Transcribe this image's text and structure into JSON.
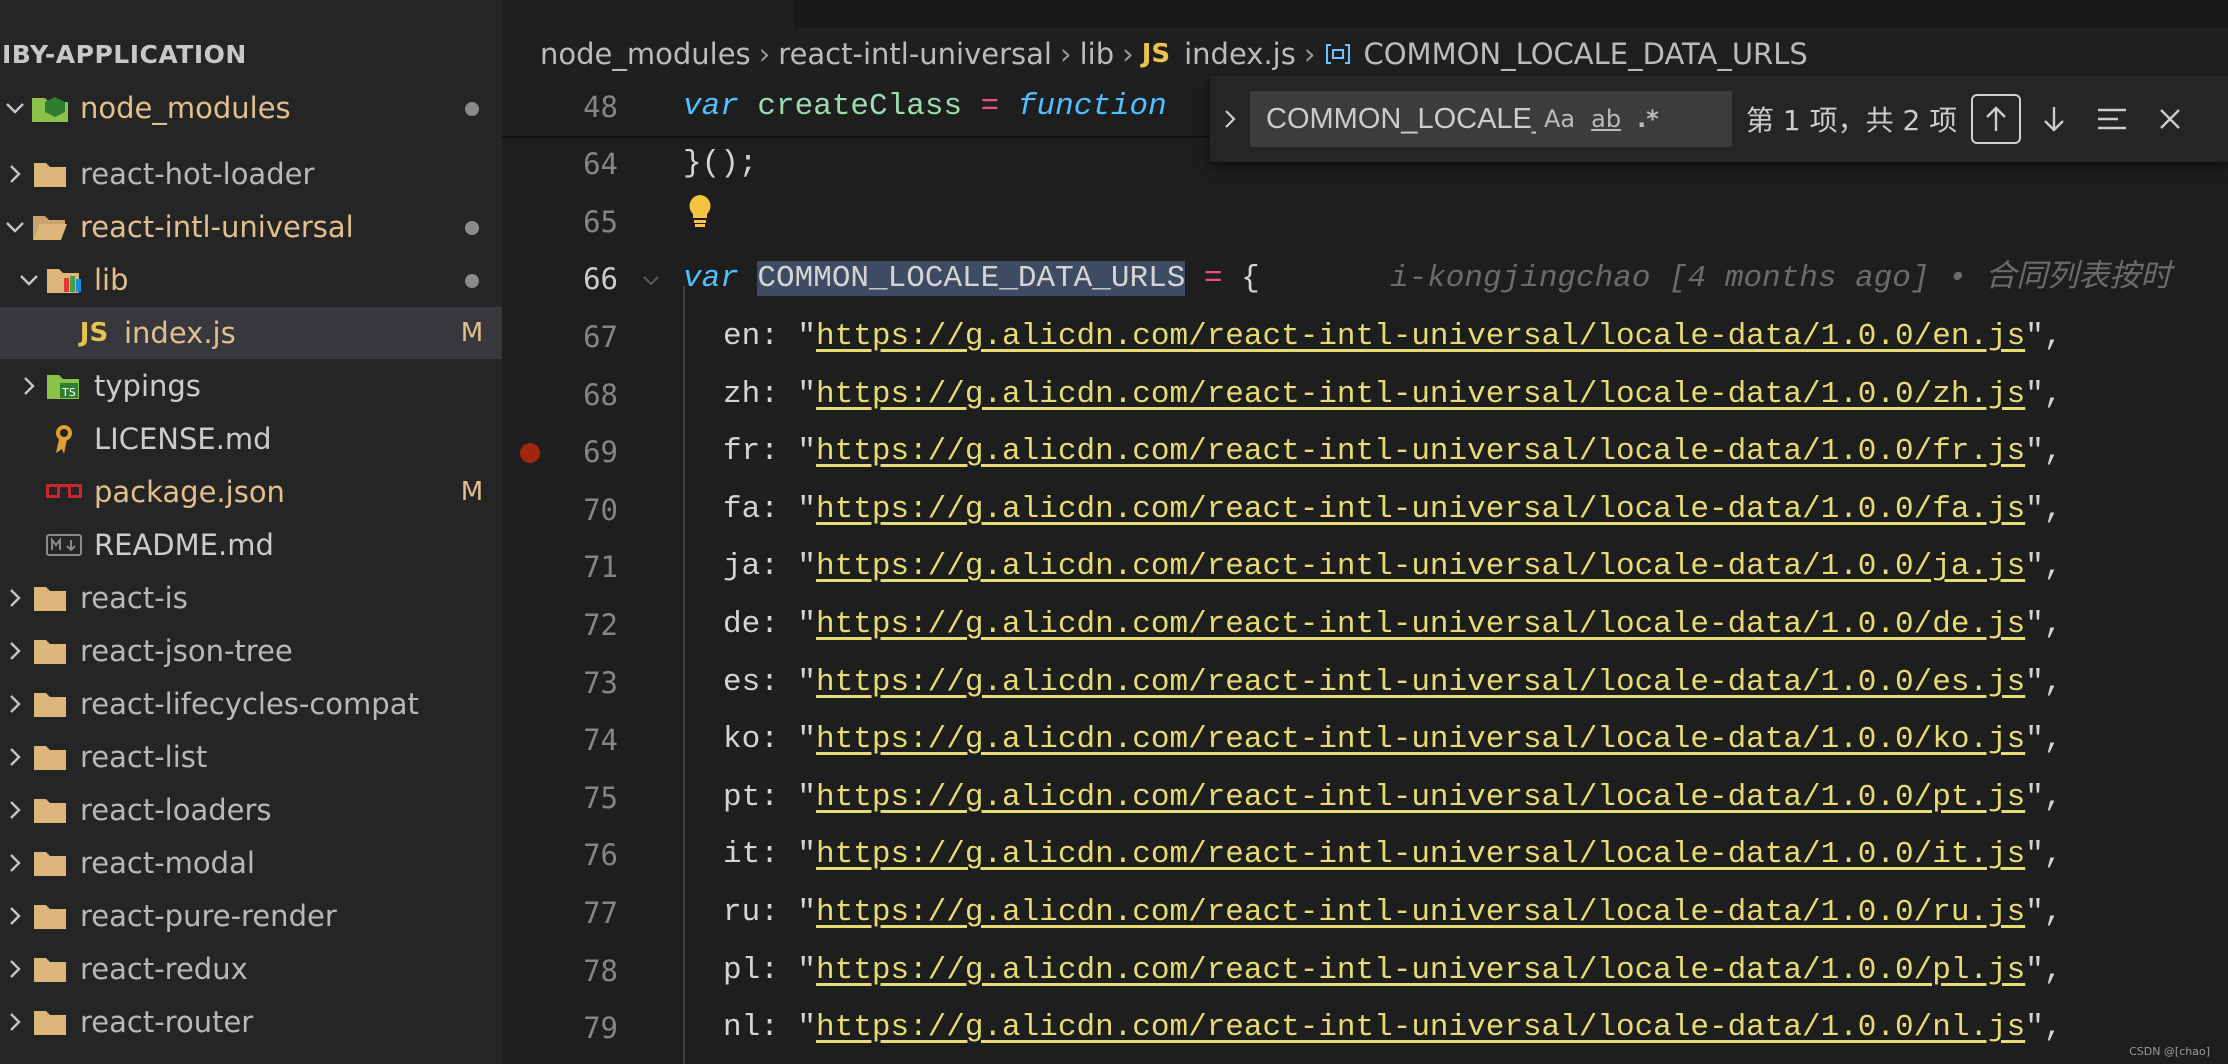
{
  "explorer": {
    "header": "IBY-APPLICATION",
    "items": [
      {
        "label": "node_modules",
        "badge": "dot",
        "kind": "folder-green",
        "chevron": "down"
      },
      {
        "label": "react-hot-loader",
        "badge": "",
        "kind": "folder",
        "chevron": "right"
      },
      {
        "label": "react-intl-universal",
        "badge": "dot",
        "kind": "folder-open",
        "chevron": "down",
        "modified": true
      },
      {
        "label": "lib",
        "badge": "dot",
        "kind": "folder-lib",
        "chevron": "down",
        "modified": true
      },
      {
        "label": "index.js",
        "badge": "M",
        "kind": "js",
        "chevron": "",
        "modified": true,
        "active": true
      },
      {
        "label": "typings",
        "badge": "",
        "kind": "folder-ts",
        "chevron": "right"
      },
      {
        "label": "LICENSE.md",
        "badge": "",
        "kind": "license",
        "chevron": ""
      },
      {
        "label": "package.json",
        "badge": "M",
        "kind": "npm",
        "chevron": "",
        "modified": true
      },
      {
        "label": "README.md",
        "badge": "",
        "kind": "markdown",
        "chevron": ""
      },
      {
        "label": "react-is",
        "badge": "",
        "kind": "folder",
        "chevron": "right"
      },
      {
        "label": "react-json-tree",
        "badge": "",
        "kind": "folder",
        "chevron": "right"
      },
      {
        "label": "react-lifecycles-compat",
        "badge": "",
        "kind": "folder",
        "chevron": "right"
      },
      {
        "label": "react-list",
        "badge": "",
        "kind": "folder",
        "chevron": "right"
      },
      {
        "label": "react-loaders",
        "badge": "",
        "kind": "folder",
        "chevron": "right"
      },
      {
        "label": "react-modal",
        "badge": "",
        "kind": "folder",
        "chevron": "right"
      },
      {
        "label": "react-pure-render",
        "badge": "",
        "kind": "folder",
        "chevron": "right"
      },
      {
        "label": "react-redux",
        "badge": "",
        "kind": "folder",
        "chevron": "right"
      },
      {
        "label": "react-router",
        "badge": "",
        "kind": "folder",
        "chevron": "right"
      }
    ]
  },
  "breadcrumb": {
    "items": [
      "node_modules",
      "react-intl-universal",
      "lib",
      "index.js",
      "COMMON_LOCALE_DATA_URLS"
    ],
    "js_badge": "JS"
  },
  "find": {
    "query": "COMMON_LOCALE_DATA_URLS",
    "match_case": "Aa",
    "whole_word": "ab",
    "regex": ".*",
    "count": "第 1 项，共 2 项"
  },
  "editor": {
    "line48": {
      "num": "48",
      "kw": "var",
      "name": "createClass",
      "op": "=",
      "fn": "function"
    },
    "line64": {
      "num": "64",
      "text": "}();"
    },
    "line65": {
      "num": "65"
    },
    "line66": {
      "num": "66",
      "kw": "var",
      "name": "COMMON_LOCALE_DATA_URLS",
      "op": "=",
      "brace": "{"
    },
    "blame": "i-kongjingchao [4 months ago] • 合同列表按时",
    "locales": [
      {
        "num": "67",
        "key": "en",
        "url": "https://g.alicdn.com/react-intl-universal/locale-data/1.0.0/en.js"
      },
      {
        "num": "68",
        "key": "zh",
        "url": "https://g.alicdn.com/react-intl-universal/locale-data/1.0.0/zh.js"
      },
      {
        "num": "69",
        "key": "fr",
        "url": "https://g.alicdn.com/react-intl-universal/locale-data/1.0.0/fr.js"
      },
      {
        "num": "70",
        "key": "fa",
        "url": "https://g.alicdn.com/react-intl-universal/locale-data/1.0.0/fa.js"
      },
      {
        "num": "71",
        "key": "ja",
        "url": "https://g.alicdn.com/react-intl-universal/locale-data/1.0.0/ja.js"
      },
      {
        "num": "72",
        "key": "de",
        "url": "https://g.alicdn.com/react-intl-universal/locale-data/1.0.0/de.js"
      },
      {
        "num": "73",
        "key": "es",
        "url": "https://g.alicdn.com/react-intl-universal/locale-data/1.0.0/es.js"
      },
      {
        "num": "74",
        "key": "ko",
        "url": "https://g.alicdn.com/react-intl-universal/locale-data/1.0.0/ko.js"
      },
      {
        "num": "75",
        "key": "pt",
        "url": "https://g.alicdn.com/react-intl-universal/locale-data/1.0.0/pt.js"
      },
      {
        "num": "76",
        "key": "it",
        "url": "https://g.alicdn.com/react-intl-universal/locale-data/1.0.0/it.js"
      },
      {
        "num": "77",
        "key": "ru",
        "url": "https://g.alicdn.com/react-intl-universal/locale-data/1.0.0/ru.js"
      },
      {
        "num": "78",
        "key": "pl",
        "url": "https://g.alicdn.com/react-intl-universal/locale-data/1.0.0/pl.js"
      },
      {
        "num": "79",
        "key": "nl",
        "url": "https://g.alicdn.com/react-intl-universal/locale-data/1.0.0/nl.js"
      }
    ]
  },
  "watermark": "CSDN @[chao]",
  "colors": {
    "accent_js": "#e8c34d",
    "modified": "#e2c08d",
    "string_url": "#e6db74",
    "keyword": "#4fc1ff",
    "breakpoint": "#a1260d"
  }
}
